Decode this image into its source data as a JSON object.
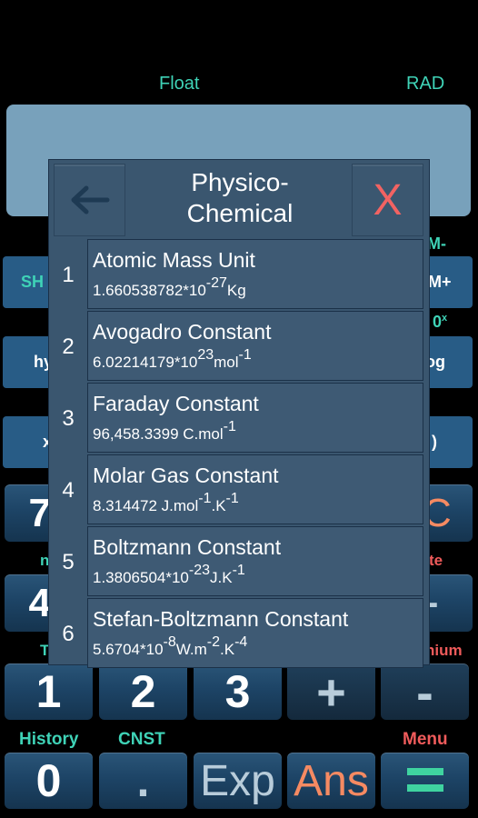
{
  "status": {
    "format_mode": "Float",
    "angle_mode": "RAD"
  },
  "display": {
    "expression": "",
    "result": ""
  },
  "background_keys": {
    "row1": {
      "label_left": "SH",
      "label_right": "M+",
      "shift_right": "M-"
    },
    "row2": {
      "label_left": "hy",
      "label_right": "og",
      "shift_right": "0x"
    },
    "row3": {
      "label_left": "x",
      "label_right": ")"
    },
    "row4": {
      "label_left": "7",
      "label_right": "C",
      "shift_left": "n",
      "shift_right": "te"
    },
    "row5": {
      "label_left": "4",
      "label_right": "-",
      "shift_left": "T",
      "shift_right": "nium"
    }
  },
  "keypad": {
    "row_digits": [
      "1",
      "2",
      "3",
      "+",
      "-"
    ],
    "shift_labels": {
      "history": "History",
      "cnst": "CNST",
      "menu": "Menu"
    },
    "row_bottom": [
      "0",
      ".",
      "Exp",
      "Ans",
      "="
    ]
  },
  "dialog": {
    "title_line1": "Physico-",
    "title_line2": "Chemical",
    "back_icon": "arrow-left-icon",
    "close_label": "X",
    "items": [
      {
        "index": "1",
        "name": "Atomic Mass Unit",
        "mantissa": "1.660538782*10",
        "exp": "-27",
        "unit": "Kg",
        "unit_parts": []
      },
      {
        "index": "2",
        "name": "Avogadro Constant",
        "mantissa": "6.02214179*10",
        "exp": "23",
        "unit": "mol",
        "unit_exp": "-1"
      },
      {
        "index": "3",
        "name": "Faraday Constant",
        "mantissa": "96,458.3399 C.mol",
        "exp": "-1",
        "unit": ""
      },
      {
        "index": "4",
        "name": "Molar Gas Constant",
        "mantissa": "8.314472 J.mol",
        "exp": "-1",
        "unit": ".K",
        "unit_exp": "-1"
      },
      {
        "index": "5",
        "name": "Boltzmann Constant",
        "mantissa": "1.3806504*10",
        "exp": "-23",
        "unit": "J.K",
        "unit_exp": "-1"
      },
      {
        "index": "6",
        "name": "Stefan-Boltzmann Constant",
        "mantissa": "5.6704*10",
        "exp": "-8",
        "unit": "W.m",
        "unit_exp": "-2",
        "unit2": ".K",
        "unit2_exp": "-4"
      }
    ]
  },
  "colors": {
    "accent_teal": "#3fd3b7",
    "accent_red": "#ef5b5b",
    "ans_orange": "#f58a62",
    "equals_green": "#3fd3a0",
    "display_bg": "#78a1bb",
    "dialog_bg": "#3a566f"
  }
}
